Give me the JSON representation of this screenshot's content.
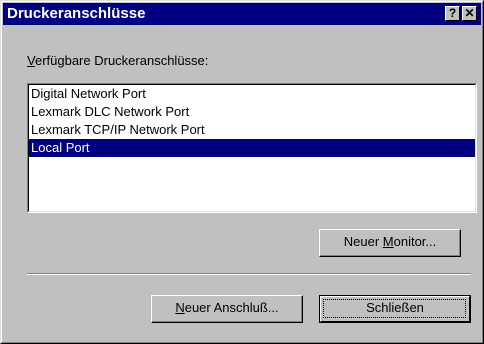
{
  "window": {
    "title": "Druckeranschlüsse",
    "help_glyph": "?",
    "close_glyph": "✕"
  },
  "ports": {
    "label_mnemonic": "V",
    "label_rest": "erfügbare Druckeranschlüsse:",
    "items": [
      {
        "label": "Digital Network Port"
      },
      {
        "label": "Lexmark DLC Network Port"
      },
      {
        "label": "Lexmark TCP/IP Network Port"
      },
      {
        "label": "Local Port",
        "selected": true
      }
    ]
  },
  "buttons": {
    "new_monitor_pre": "Neuer ",
    "new_monitor_mnemonic": "M",
    "new_monitor_post": "onitor...",
    "new_port_pre": "",
    "new_port_mnemonic": "N",
    "new_port_post": "euer Anschluß...",
    "close_label": "Schließen"
  },
  "colors": {
    "titlebar": "#000080",
    "face": "#c0c0c0",
    "selection": "#000080"
  },
  "icons": {
    "help": "help-icon",
    "close": "close-icon"
  }
}
